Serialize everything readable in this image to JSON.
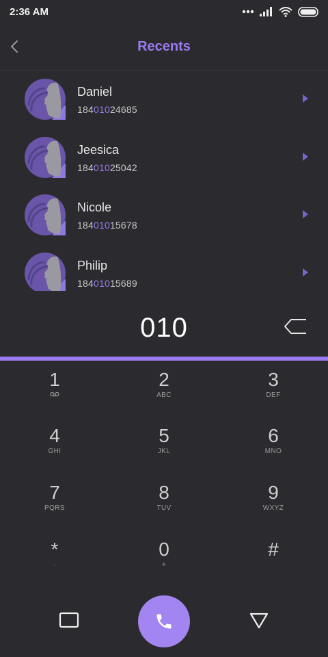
{
  "status_bar": {
    "time": "2:36 AM",
    "icons": [
      "more-dots-icon",
      "signal-icon",
      "wifi-icon",
      "battery-icon"
    ]
  },
  "header": {
    "title": "Recents",
    "back_icon": "chevron-left-icon"
  },
  "contacts": [
    {
      "name": "Daniel",
      "number_prefix": "184",
      "number_match": "010",
      "number_suffix": "24685"
    },
    {
      "name": "Jeesica",
      "number_prefix": "184",
      "number_match": "010",
      "number_suffix": "25042"
    },
    {
      "name": "Nicole",
      "number_prefix": "184",
      "number_match": "010",
      "number_suffix": "15678"
    },
    {
      "name": "Philip",
      "number_prefix": "184",
      "number_match": "010",
      "number_suffix": "15689"
    }
  ],
  "dialer": {
    "value": "010",
    "backspace_icon": "backspace-icon"
  },
  "keypad": [
    {
      "digit": "1",
      "letters": ""
    },
    {
      "digit": "2",
      "letters": "ABC"
    },
    {
      "digit": "3",
      "letters": "DEF"
    },
    {
      "digit": "4",
      "letters": "GHI"
    },
    {
      "digit": "5",
      "letters": "JKL"
    },
    {
      "digit": "6",
      "letters": "MNO"
    },
    {
      "digit": "7",
      "letters": "PQRS"
    },
    {
      "digit": "8",
      "letters": "TUV"
    },
    {
      "digit": "9",
      "letters": "WXYZ"
    },
    {
      "digit": "*",
      "letters": "·"
    },
    {
      "digit": "0",
      "letters": "+"
    },
    {
      "digit": "#",
      "letters": ""
    }
  ],
  "nav": {
    "left_icon": "square-icon",
    "call_icon": "phone-icon",
    "right_icon": "triangle-down-icon"
  },
  "colors": {
    "accent": "#9a7af0",
    "background": "#2b2a2e",
    "call_button": "#a385f2"
  }
}
